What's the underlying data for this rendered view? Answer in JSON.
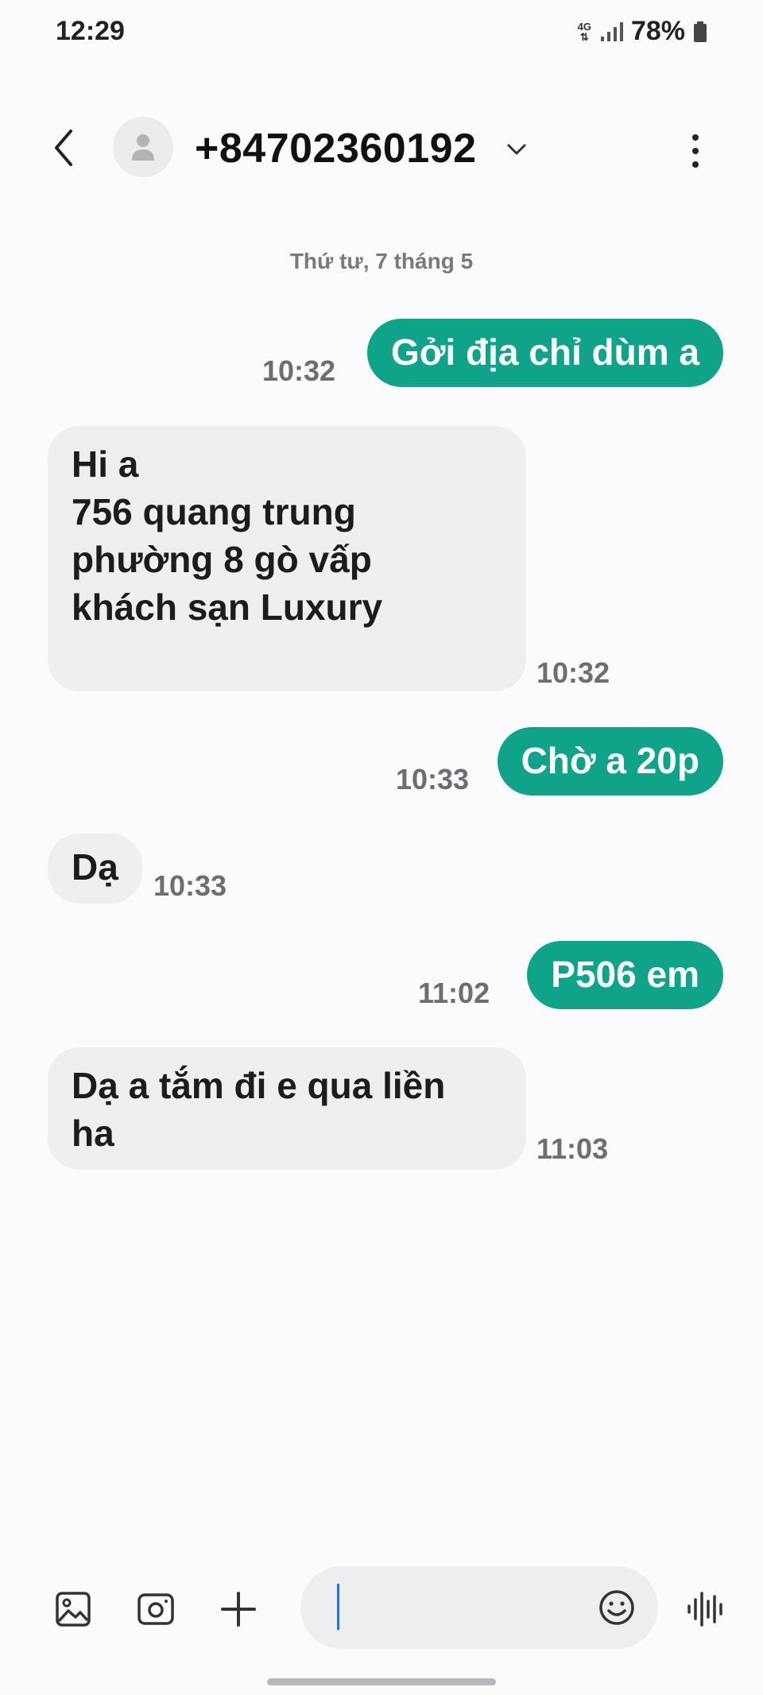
{
  "status_bar": {
    "time": "12:29",
    "network": "4G",
    "battery": "78%"
  },
  "header": {
    "contact": "+84702360192"
  },
  "conversation": {
    "date": "Thứ tư, 7 tháng 5",
    "messages": [
      {
        "direction": "outgoing",
        "lines": [
          "Gởi địa chỉ dùm a"
        ],
        "time": "10:32"
      },
      {
        "direction": "incoming",
        "lines": [
          "Hi a",
          "756 quang trung",
          "phường 8 gò vấp",
          "khách sạn Luxury"
        ],
        "time": "10:32"
      },
      {
        "direction": "outgoing",
        "lines": [
          "Chờ a 20p"
        ],
        "time": "10:33"
      },
      {
        "direction": "incoming",
        "lines": [
          "Dạ"
        ],
        "time": "10:33"
      },
      {
        "direction": "outgoing",
        "lines": [
          "P506 em"
        ],
        "time": "11:02"
      },
      {
        "direction": "incoming",
        "lines": [
          "Dạ a tắm đi e qua liền",
          "ha"
        ],
        "time": "11:03"
      }
    ]
  },
  "composer": {
    "text": ""
  },
  "icons": {
    "back": "back-arrow-icon",
    "avatar": "person-icon",
    "more": "more-vertical-icon",
    "gallery": "gallery-icon",
    "camera": "camera-icon",
    "add": "plus-icon",
    "emoji": "emoji-icon",
    "voice": "voice-wave-icon"
  },
  "colors": {
    "outgoing_bubble": "#0fa38a",
    "incoming_bubble": "#efeff1",
    "background": "#fbfbfd"
  }
}
